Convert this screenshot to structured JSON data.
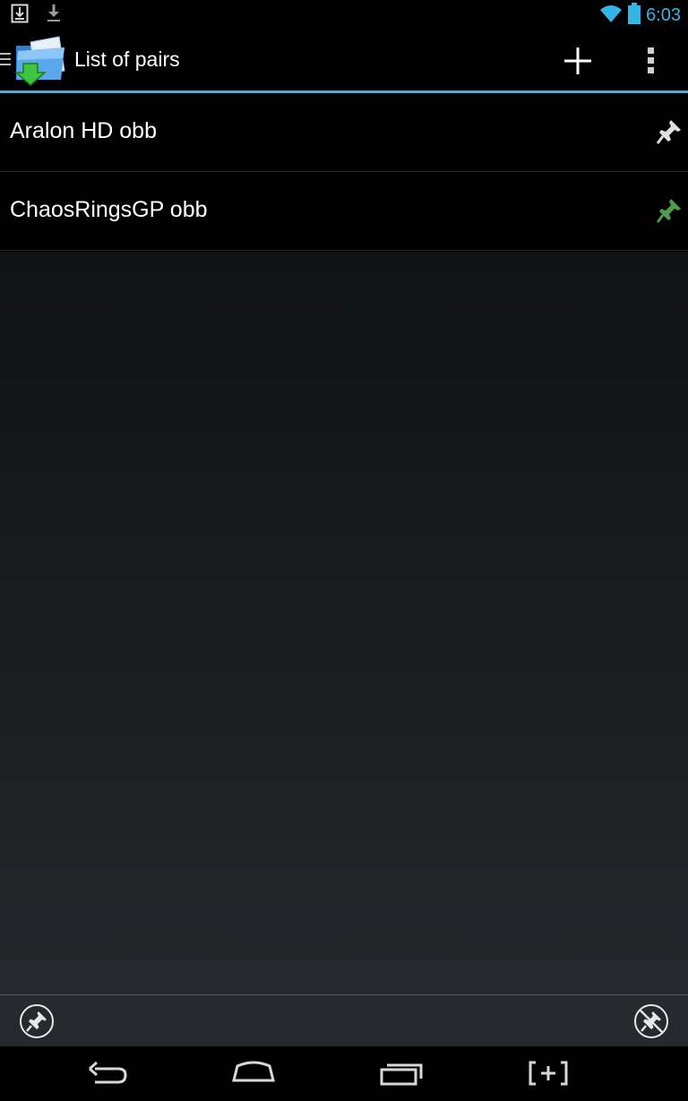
{
  "status_bar": {
    "time": "6:03",
    "left_icons": [
      "download-notification-icon",
      "download-arrow-icon"
    ],
    "right_icons": [
      "wifi-icon",
      "battery-icon"
    ],
    "accent_color": "#33b5e5"
  },
  "action_bar": {
    "title": "List of pairs",
    "app_icon": "folder-sync-app-icon",
    "actions": [
      "add-icon",
      "overflow-menu-icon"
    ],
    "accent_color": "#33b5e5"
  },
  "pairs": [
    {
      "label": "Aralon HD obb",
      "pin_icon": "pin-icon",
      "pin_color": "#e0e0e0"
    },
    {
      "label": "ChaosRingsGP obb",
      "pin_icon": "pin-icon",
      "pin_color": "#4f9a4f"
    }
  ],
  "bottom_bar": {
    "left_button": "pin-all-icon",
    "right_button": "unpin-all-icon"
  },
  "nav_bar": {
    "buttons": [
      "back-icon",
      "home-icon",
      "recent-apps-icon",
      "screenshot-icon"
    ]
  }
}
